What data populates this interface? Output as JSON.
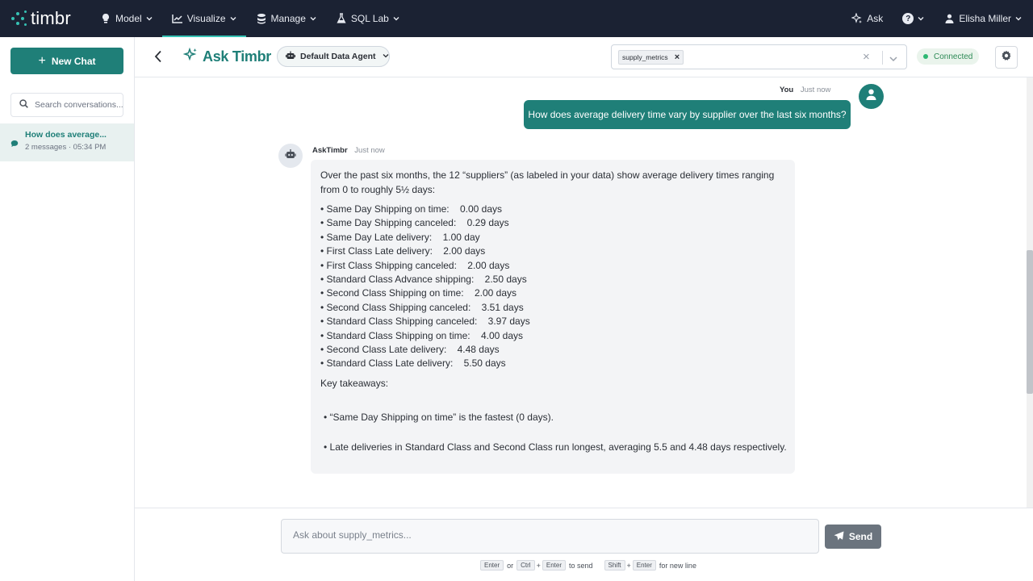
{
  "app": {
    "logo_text": "timbr",
    "brand_color": "#1f7f78",
    "nav_bg": "#1b2233"
  },
  "topnav": {
    "items": [
      {
        "label": "Model",
        "icon": "lightbulb-icon"
      },
      {
        "label": "Visualize",
        "icon": "chart-icon",
        "active": true
      },
      {
        "label": "Manage",
        "icon": "database-icon"
      },
      {
        "label": "SQL Lab",
        "icon": "flask-icon"
      }
    ],
    "ask_label": "Ask",
    "user_name": "Elisha Miller"
  },
  "sidebar": {
    "new_chat_label": "New Chat",
    "search_placeholder": "Search conversations...",
    "conversations": [
      {
        "title": "How does average...",
        "meta": "2 messages · 05:34 PM"
      }
    ]
  },
  "header": {
    "title": "Ask Timbr",
    "agent_label": "Default Data Agent",
    "selected_tag": "supply_metrics",
    "status": "Connected"
  },
  "chat": {
    "user": {
      "name": "You",
      "time": "Just now",
      "message": "How does average delivery time vary by supplier over the last six months?"
    },
    "bot": {
      "name": "AskTimbr",
      "time": "Just now",
      "intro": "Over the past six months, the 12 “suppliers” (as labeled in your data) show average delivery times ranging from 0 to roughly 5½ days:",
      "list": [
        "• Same Day Shipping on time:    0.00 days",
        "• Same Day Shipping canceled:    0.29 days",
        "• Same Day Late delivery:    1.00 day",
        "• First Class Late delivery:    2.00 days",
        "• First Class Shipping canceled:    2.00 days",
        "• Standard Class Advance shipping:    2.50 days",
        "• Second Class Shipping on time:    2.00 days",
        "• Second Class Shipping canceled:    3.51 days",
        "• Standard Class Shipping canceled:    3.97 days",
        "• Standard Class Shipping on time:    4.00 days",
        "• Second Class Late delivery:    4.48 days",
        "• Standard Class Late delivery:    5.50 days"
      ],
      "key_title": "Key takeaways:",
      "takeaways": [
        "•  “Same Day Shipping on time” is the fastest (0 days).",
        "•  Late deliveries in Standard Class and Second Class run longest, averaging 5.5 and 4.48 days respectively."
      ]
    }
  },
  "composer": {
    "placeholder": "Ask about supply_metrics...",
    "send_label": "Send",
    "hint": {
      "enter": "Enter",
      "or": "or",
      "ctrl": "Ctrl",
      "plus": "+",
      "to_send": "to send",
      "shift": "Shift",
      "new_line": "for new line"
    }
  }
}
